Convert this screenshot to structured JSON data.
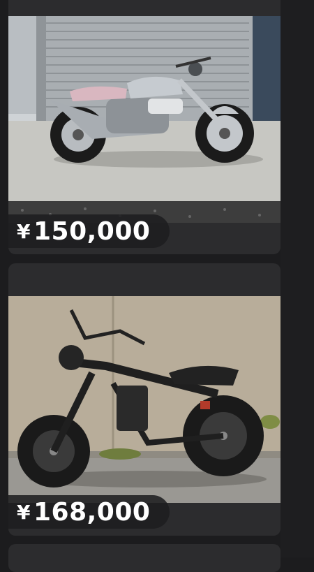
{
  "listings": [
    {
      "currency_symbol": "¥",
      "price": "150,000",
      "image_subject": "silver cruiser motorcycle"
    },
    {
      "currency_symbol": "¥",
      "price": "168,000",
      "image_subject": "black fat-tire electric bike"
    }
  ],
  "colors": {
    "background": "#1c1c1e",
    "card": "#2c2c2e",
    "price_text": "#ffffff"
  }
}
